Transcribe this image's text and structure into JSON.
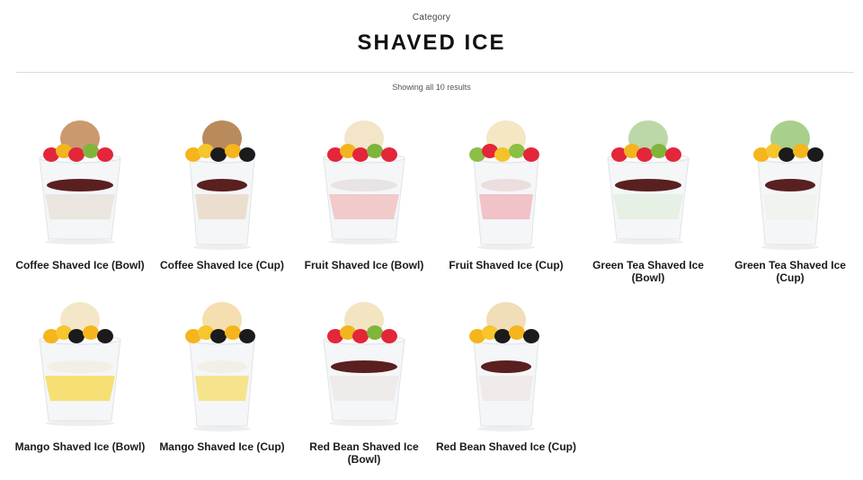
{
  "header": {
    "eyebrow": "Category",
    "title": "SHAVED ICE"
  },
  "results": {
    "label": "Showing all 10 results"
  },
  "products": [
    {
      "name": "Coffee Shaved Ice (Bowl)",
      "scoop": "#c99a6e",
      "syrup": "#e8e2da",
      "beans": "#5a1f1f",
      "topping": "fruit",
      "shape": "bowl"
    },
    {
      "name": "Coffee Shaved Ice (Cup)",
      "scoop": "#b98a5c",
      "syrup": "#ead9c8",
      "beans": "#5a1f1f",
      "topping": "mango",
      "shape": "cup"
    },
    {
      "name": "Fruit Shaved Ice (Bowl)",
      "scoop": "#f3e6c8",
      "syrup": "#f0c2c2",
      "beans": "#e9e4e4",
      "topping": "fruit",
      "shape": "bowl"
    },
    {
      "name": "Fruit Shaved Ice (Cup)",
      "scoop": "#f5e6c4",
      "syrup": "#f0b8bf",
      "beans": "#ecdede",
      "topping": "kiwi",
      "shape": "cup"
    },
    {
      "name": "Green Tea Shaved Ice (Bowl)",
      "scoop": "#bcd7a8",
      "syrup": "#e4eee0",
      "beans": "#5a1f1f",
      "topping": "fruit",
      "shape": "bowl"
    },
    {
      "name": "Green Tea Shaved Ice (Cup)",
      "scoop": "#a9cf8d",
      "syrup": "#eef2ec",
      "beans": "#5a1f1f",
      "topping": "mango",
      "shape": "cup"
    },
    {
      "name": "Mango Shaved Ice (Bowl)",
      "scoop": "#f4e7c7",
      "syrup": "#f6dc5c",
      "beans": "#f2efe6",
      "topping": "mango",
      "shape": "bowl"
    },
    {
      "name": "Mango Shaved Ice (Cup)",
      "scoop": "#f5deb0",
      "syrup": "#f6e07a",
      "beans": "#f2efe6",
      "topping": "mango",
      "shape": "cup"
    },
    {
      "name": "Red Bean Shaved Ice (Bowl)",
      "scoop": "#f3e5c2",
      "syrup": "#efe9e9",
      "beans": "#5a1f1f",
      "topping": "fruit",
      "shape": "bowl"
    },
    {
      "name": "Red Bean Shaved Ice (Cup)",
      "scoop": "#f1ddb7",
      "syrup": "#efe8e8",
      "beans": "#5a1f1f",
      "topping": "mango",
      "shape": "cup"
    }
  ]
}
